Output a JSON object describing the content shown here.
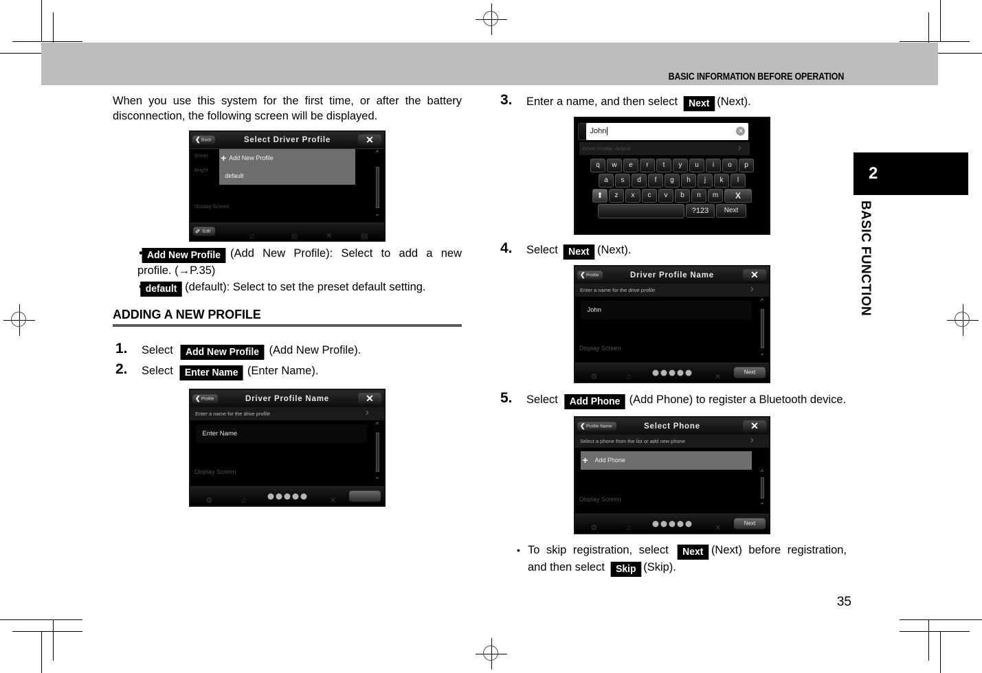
{
  "header": {
    "title": "BASIC INFORMATION BEFORE OPERATION"
  },
  "sidebar": {
    "chapter_number": "2",
    "chapter_name": "BASIC FUNCTION"
  },
  "page_number": "35",
  "left_column": {
    "intro_paragraph": "When you use this system for the first time, or after the battery disconnection, the following screen will be displayed.",
    "figure_select_driver_profile": {
      "title": "Select Driver Profile",
      "back_label": "Back",
      "close_icon": "close-x-icon",
      "ghost_rows": [
        "Driver",
        "Bright",
        "Display Screen"
      ],
      "list_items": [
        "Add New Profile",
        "default"
      ],
      "edit_label": "Edit"
    },
    "bullets": [
      {
        "key": "Add New Profile",
        "text": "(Add New Profile): Select to add a new profile. (→P.35)"
      },
      {
        "key": "default",
        "text": "(default): Select to set the preset default setting."
      }
    ],
    "section_heading": "ADDING A NEW PROFILE",
    "steps": [
      {
        "number": "1.",
        "pre": "Select",
        "key": "Add New Profile",
        "post": "(Add New Profile)."
      },
      {
        "number": "2.",
        "pre": "Select",
        "key": "Enter Name",
        "post": "(Enter Name)."
      }
    ],
    "figure_driver_profile_name_empty": {
      "title": "Driver Profile Name",
      "back_label": "Profile",
      "close_icon": "close-x-icon",
      "subline": "Enter a name for the drive profile",
      "field_value": "Enter Name",
      "ghost_row": "Display Screen",
      "dots_count": 5
    }
  },
  "right_column": {
    "steps": [
      {
        "number": "3.",
        "pre": "Enter a name, and then select",
        "key": "Next",
        "post": "(Next)."
      },
      {
        "number": "4.",
        "pre": "Select",
        "key": "Next",
        "post": "(Next)."
      },
      {
        "number": "5.",
        "pre": "Select",
        "key": "Add Phone",
        "post": "(Add Phone) to register a Bluetooth device."
      }
    ],
    "figure_keyboard": {
      "input_value": "John",
      "back_icon": "chevron-left-icon",
      "clear_icon": "clear-circle-x-icon",
      "ghost_row": "Driver Profile: default",
      "row1": [
        "q",
        "w",
        "e",
        "r",
        "t",
        "y",
        "u",
        "i",
        "o",
        "p"
      ],
      "row2": [
        "a",
        "s",
        "d",
        "f",
        "g",
        "h",
        "j",
        "k",
        "l"
      ],
      "row3": [
        "z",
        "x",
        "c",
        "v",
        "b",
        "n",
        "m"
      ],
      "shift_icon": "shift-arrow-up-icon",
      "delete_label": "X",
      "symbol_label": "?123",
      "next_label": "Next"
    },
    "figure_driver_profile_name_filled": {
      "title": "Driver Profile Name",
      "back_label": "Profile",
      "close_icon": "close-x-icon",
      "subline": "Enter a name for the drive profile",
      "field_value": "John",
      "ghost_row": "Display Screen",
      "dots_count": 5,
      "next_label": "Next"
    },
    "figure_select_phone": {
      "title": "Select Phone",
      "back_label": "Profile Name",
      "close_icon": "close-x-icon",
      "subline": "Select a phone from the list or add new phone",
      "list_item": "Add Phone",
      "ghost_row": "Display Screen",
      "dots_count": 5,
      "next_label": "Next"
    },
    "note_bullet": {
      "pre": "To skip registration, select",
      "key1": "Next",
      "mid": "(Next) before registration, and then select",
      "key2": "Skip",
      "post": "(Skip)."
    }
  }
}
